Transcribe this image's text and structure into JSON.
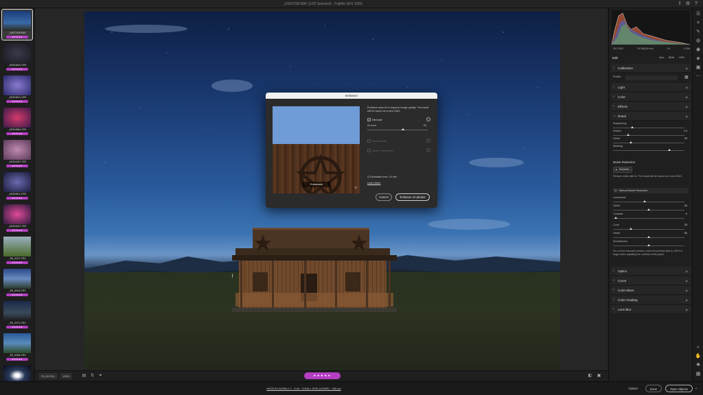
{
  "titlebar": {
    "title": "_DSF0708.RAF (1/22 Selected) · Fujifilm GFX 100S"
  },
  "filmstrip": {
    "items": [
      {
        "name": "_DSF0708.RAF",
        "stars": "★★★★★",
        "selected": true
      },
      {
        "name": "_MOD4604.CR3",
        "stars": "★★★★★"
      },
      {
        "name": "_MOD4621.CR3",
        "stars": "★★★★★"
      },
      {
        "name": "_MOD4684.CR3",
        "stars": "★★★★★"
      },
      {
        "name": "_MOD4487.CR3",
        "stars": "★★★★★"
      },
      {
        "name": "_MOD4811.CR3",
        "stars": "★★★★★"
      },
      {
        "name": "_MOD4047.CR3",
        "stars": "★★★★★"
      },
      {
        "name": "_R5_0237.CR3",
        "stars": "★★★★★"
      },
      {
        "name": "_R5_0043.CR3",
        "stars": "★★★★★"
      },
      {
        "name": "_R5_0371.CR3",
        "stars": "★★★★★"
      },
      {
        "name": "_R5_5496.CR3",
        "stars": "★★★★★"
      }
    ]
  },
  "bottombar": {
    "fit_label": "Fit (39.9%)",
    "zoom_label": "100%",
    "rating": "★★★★★"
  },
  "footer": {
    "info": "sRGB IEC61966-2.1 - 8 bit - 11648 x 8736 (102MP) - 300 ppi",
    "cancel_label": "Cancel",
    "done_label": "Done",
    "open_label": "Open Objects"
  },
  "panel": {
    "histogram_meta": [
      "ISO 3200",
      "20-35@35 mm",
      "f/4",
      "4.00s"
    ],
    "edit_label": "Edit",
    "modes": [
      "Auto",
      "B&W",
      "HDR"
    ],
    "sections_top": [
      "Calibration"
    ],
    "profile_label": "Profile",
    "sections_mid": [
      "Light",
      "Color",
      "Effects"
    ],
    "detail_label": "Detail",
    "sharpening": [
      {
        "label": "Sharpening",
        "value": ""
      },
      {
        "label": "Radius",
        "value": "1.0"
      },
      {
        "label": "Detail",
        "value": "25"
      },
      {
        "label": "Masking",
        "value": ""
      }
    ],
    "noise_reduction_title": "Noise Reduction",
    "denoise_label": "Denoise...",
    "nr_desc": "Reduce noise with AI. The result will be saved as a new DNG.",
    "manual_nr_label": "Manual Noise Reduction",
    "manual_sliders": [
      {
        "label": "Luminance",
        "value": ""
      },
      {
        "label": "Detail",
        "value": "50"
      },
      {
        "label": "Contrast",
        "value": "0"
      },
      {
        "label": "Color",
        "value": "25"
      },
      {
        "label": "Detail",
        "value": "50"
      },
      {
        "label": "Smoothness",
        "value": ""
      }
    ],
    "preview_note": "For a more accurate preview, zoom the preview size to 100% or larger when adjusting the controls in this panel.",
    "sections_bottom": [
      "Optics",
      "Curve",
      "Color Mixer",
      "Color Grading",
      "Lens Blur"
    ]
  },
  "dialog": {
    "title": "Enhance",
    "description": "Enhance uses AI to improve image quality. The result will be saved as a new DNG.",
    "denoise_label": "Denoise",
    "amount_label": "Amount",
    "amount_value": "68",
    "raw_details_label": "Raw Details",
    "super_resolution_label": "Super Resolution",
    "estimated_time": "Estimated time: 15 min",
    "learn_more": "Learn More",
    "preview_label": "Enhanced",
    "cancel_label": "Cancel",
    "enhance_label": "Enhance 12 photos"
  },
  "colors": {
    "accent_rating": "#b53fc2",
    "panel_bg": "#1f1f1f"
  }
}
